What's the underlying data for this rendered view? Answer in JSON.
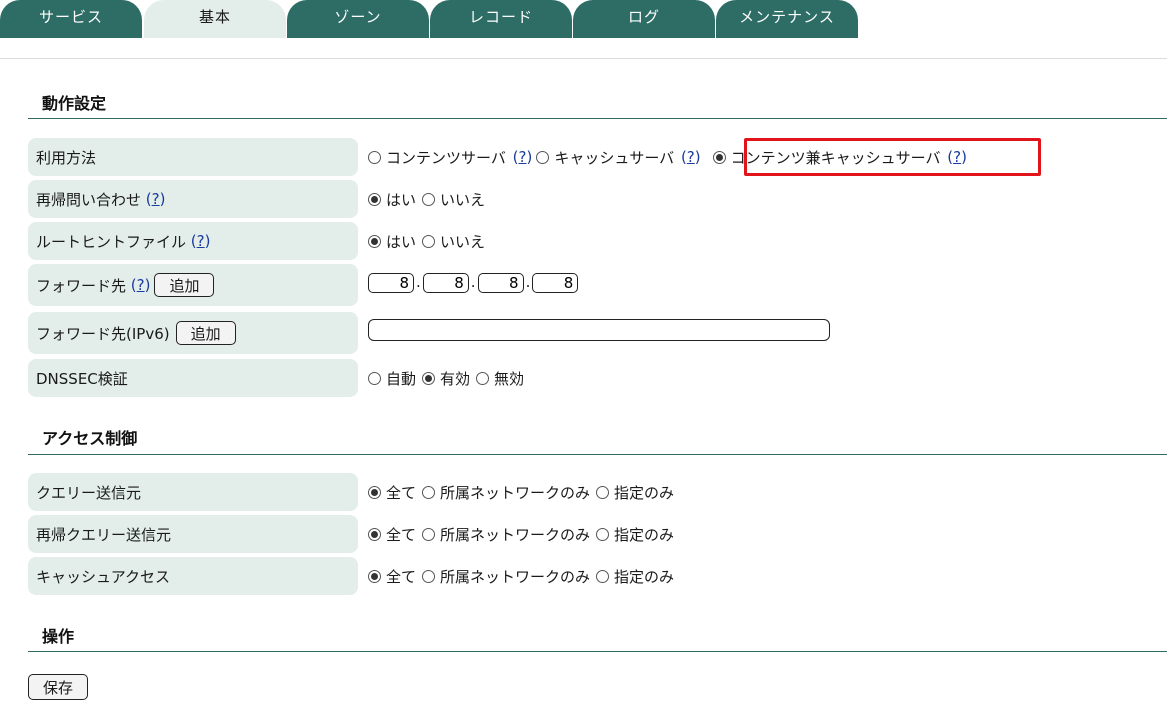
{
  "tabs": [
    "サービス",
    "基本",
    "ゾーン",
    "レコード",
    "ログ",
    "メンテナンス"
  ],
  "active_tab": "基本",
  "sections": {
    "operation_settings": "動作設定",
    "access_control": "アクセス制御",
    "operations": "操作"
  },
  "help_text": "?",
  "rows": {
    "usage": {
      "label": "利用方法",
      "options": [
        "コンテンツサーバ",
        "キャッシュサーバ",
        "コンテンツ兼キャッシュサーバ"
      ],
      "selected": "コンテンツ兼キャッシュサーバ"
    },
    "recursive": {
      "label": "再帰問い合わせ",
      "options": [
        "はい",
        "いいえ"
      ],
      "selected": "はい"
    },
    "root_hint": {
      "label": "ルートヒントファイル",
      "options": [
        "はい",
        "いいえ"
      ],
      "selected": "はい"
    },
    "forward": {
      "label": "フォワード先",
      "add_label": "追加",
      "ip": [
        "8",
        "8",
        "8",
        "8"
      ]
    },
    "forward_ipv6": {
      "label": "フォワード先(IPv6)",
      "add_label": "追加",
      "value": ""
    },
    "dnssec": {
      "label": "DNSSEC検証",
      "options": [
        "自動",
        "有効",
        "無効"
      ],
      "selected": "有効"
    },
    "query_source": {
      "label": "クエリー送信元",
      "options": [
        "全て",
        "所属ネットワークのみ",
        "指定のみ"
      ],
      "selected": "全て"
    },
    "recursive_query_source": {
      "label": "再帰クエリー送信元",
      "options": [
        "全て",
        "所属ネットワークのみ",
        "指定のみ"
      ],
      "selected": "全て"
    },
    "cache_access": {
      "label": "キャッシュアクセス",
      "options": [
        "全て",
        "所属ネットワークのみ",
        "指定のみ"
      ],
      "selected": "全て"
    }
  },
  "save_label": "保存",
  "colors": {
    "tab": "#2d6d66",
    "tab_active": "#e3eeeb",
    "label_bg": "#e3eeeb",
    "highlight": "#e0141a",
    "link": "#1a3a9e"
  }
}
